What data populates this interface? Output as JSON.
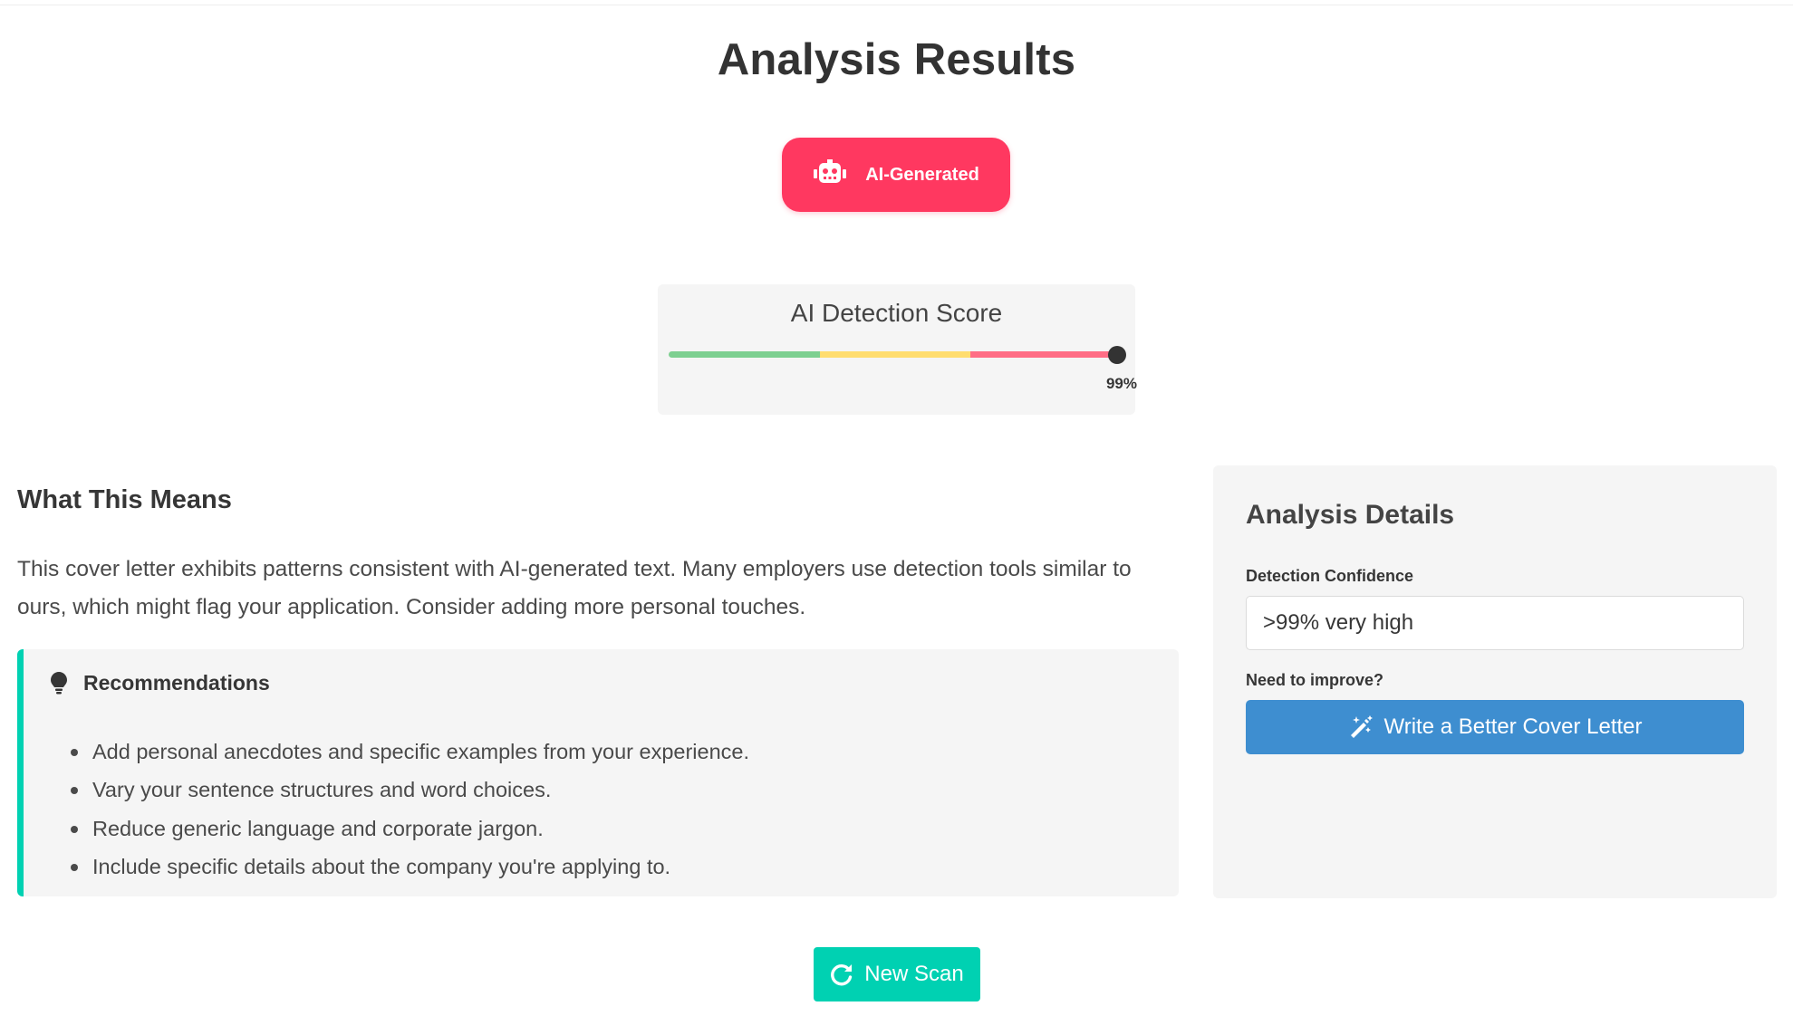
{
  "page": {
    "title": "Analysis Results"
  },
  "verdict": {
    "label": "AI-Generated",
    "icon": "robot-icon",
    "color": "#ff3860"
  },
  "score": {
    "title": "AI Detection Score",
    "value_label": "99%",
    "value_fraction": 0.99,
    "gradient_colors": [
      "#7ed091",
      "#ffdd70",
      "#ff6e86"
    ]
  },
  "explanation": {
    "title": "What This Means",
    "text": "This cover letter exhibits patterns consistent with AI-generated text. Many employers use detection tools similar to ours, which might flag your application. Consider adding more personal touches."
  },
  "recommendations": {
    "title": "Recommendations",
    "icon": "lightbulb-icon",
    "accent_color": "#00d1b2",
    "items": [
      "Add personal anecdotes and specific examples from your experience.",
      "Vary your sentence structures and word choices.",
      "Reduce generic language and corporate jargon.",
      "Include specific details about the company you're applying to."
    ]
  },
  "details": {
    "title": "Analysis Details",
    "confidence_label": "Detection Confidence",
    "confidence_value": ">99% very high",
    "improve_label": "Need to improve?",
    "improve_button": "Write a Better Cover Letter",
    "improve_icon": "magic-wand-icon",
    "button_color": "#3e8ed0"
  },
  "actions": {
    "new_scan_label": "New Scan",
    "new_scan_icon": "redo-icon",
    "new_scan_color": "#00d1b2"
  }
}
